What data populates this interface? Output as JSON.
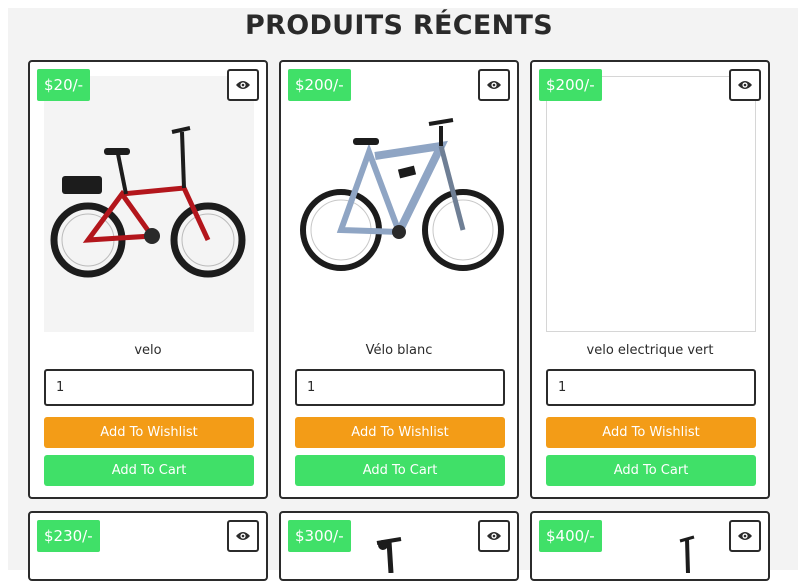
{
  "page": {
    "title": "PRODUITS RÉCENTS"
  },
  "products": [
    {
      "price": "$20/-",
      "name": "velo",
      "quantity": "1",
      "wishlist_label": "Add To Wishlist",
      "cart_label": "Add To Cart"
    },
    {
      "price": "$200/-",
      "name": "Vélo blanc",
      "quantity": "1",
      "wishlist_label": "Add To Wishlist",
      "cart_label": "Add To Cart"
    },
    {
      "price": "$200/-",
      "name": "velo electrique vert",
      "quantity": "1",
      "wishlist_label": "Add To Wishlist",
      "cart_label": "Add To Cart"
    },
    {
      "price": "$230/-"
    },
    {
      "price": "$300/-"
    },
    {
      "price": "$400/-"
    }
  ],
  "icons": {
    "quick_view": "eye-icon"
  },
  "colors": {
    "price_badge": "#40e068",
    "wishlist_button": "#f39c17",
    "cart_button": "#40e068",
    "border": "#2b2b2b"
  }
}
